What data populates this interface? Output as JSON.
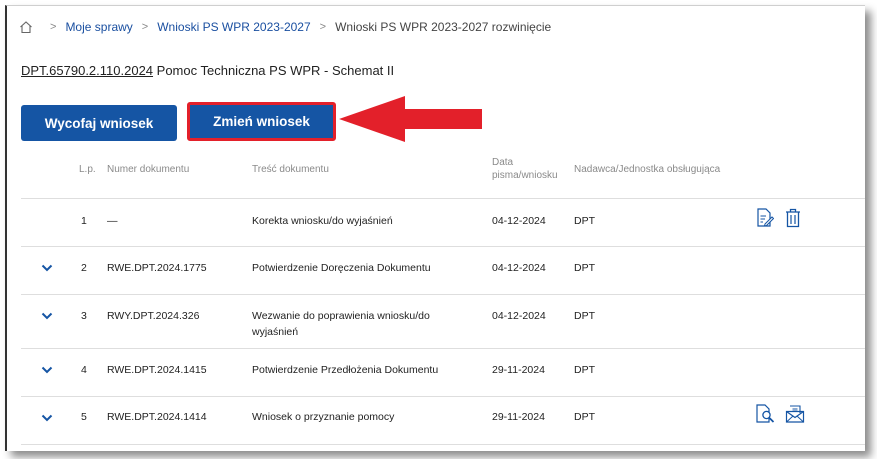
{
  "breadcrumb": {
    "items": [
      "Moje sprawy",
      "Wnioski PS WPR 2023-2027",
      "Wnioski PS WPR 2023-2027 rozwinięcie"
    ]
  },
  "case": {
    "code": "DPT.65790.2.110.2024",
    "name": "Pomoc Techniczna PS WPR - Schemat II"
  },
  "buttons": {
    "withdraw": "Wycofaj wniosek",
    "change": "Zmień wniosek"
  },
  "table": {
    "headers": {
      "lp": "L.p.",
      "number": "Numer dokumentu",
      "content": "Treść dokumentu",
      "date_line1": "Data",
      "date_line2": "pisma/wniosku",
      "sender": "Nadawca/Jednostka obsługująca"
    },
    "rows": [
      {
        "lp": "1",
        "number": "—",
        "content": "Korekta wniosku/do wyjaśnień",
        "content2": "",
        "date": "04-12-2024",
        "sender": "DPT",
        "expandable": false,
        "actions": [
          "edit-document-icon",
          "trash-icon"
        ]
      },
      {
        "lp": "2",
        "number": "RWE.DPT.2024.1775",
        "content": "Potwierdzenie Doręczenia Dokumentu",
        "content2": "",
        "date": "04-12-2024",
        "sender": "DPT",
        "expandable": true,
        "actions": []
      },
      {
        "lp": "3",
        "number": "RWY.DPT.2024.326",
        "content": "Wezwanie do poprawienia wniosku/do",
        "content2": "wyjaśnień",
        "date": "04-12-2024",
        "sender": "DPT",
        "expandable": true,
        "actions": []
      },
      {
        "lp": "4",
        "number": "RWE.DPT.2024.1415",
        "content": "Potwierdzenie Przedłożenia Dokumentu",
        "content2": "",
        "date": "29-11-2024",
        "sender": "DPT",
        "expandable": true,
        "actions": []
      },
      {
        "lp": "5",
        "number": "RWE.DPT.2024.1414",
        "content": "Wniosek o przyznanie pomocy",
        "content2": "",
        "date": "29-11-2024",
        "sender": "DPT",
        "expandable": true,
        "actions": [
          "document-search-icon",
          "envelope-icon"
        ]
      }
    ]
  },
  "colors": {
    "primary": "#1555a4",
    "link": "#1a4fa0",
    "highlight": "#e3202a"
  }
}
